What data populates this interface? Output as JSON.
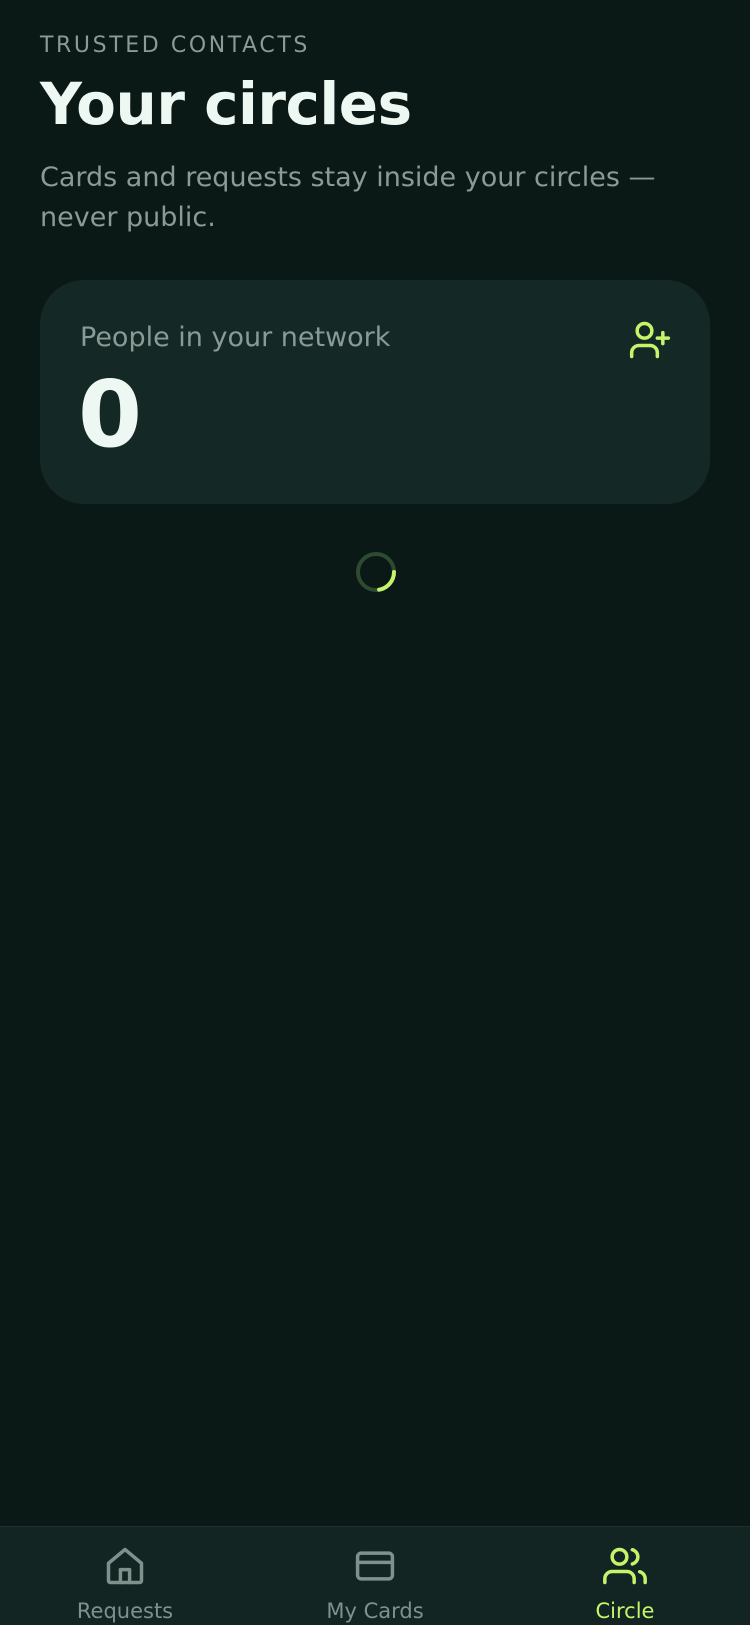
{
  "header": {
    "eyebrow": "TRUSTED CONTACTS",
    "title": "Your circles",
    "subtitle": "Cards and requests stay inside your circles — never public."
  },
  "network_card": {
    "label": "People in your network",
    "count": "0",
    "action_icon": "user-plus-icon"
  },
  "loading": {
    "icon": "loading-spinner-icon"
  },
  "tabbar": {
    "tabs": [
      {
        "label": "Requests",
        "icon": "home-icon",
        "active": false
      },
      {
        "label": "My Cards",
        "icon": "credit-card-icon",
        "active": false
      },
      {
        "label": "Circle",
        "icon": "users-icon",
        "active": true
      }
    ]
  },
  "colors": {
    "background": "#0a1816",
    "card": "#142926",
    "accent": "#c5f46a",
    "muted_text": "#8a9a95",
    "primary_text": "#eef8f2"
  }
}
